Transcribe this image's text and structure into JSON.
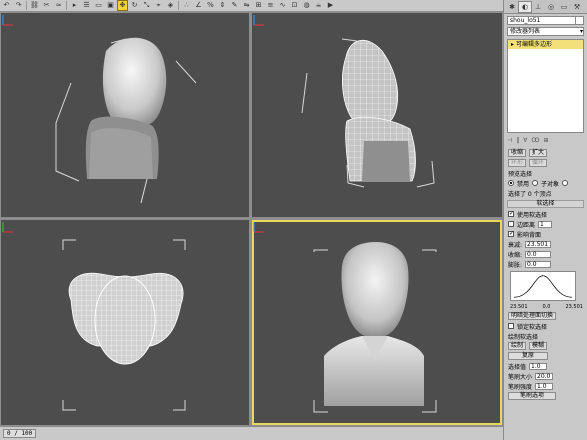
{
  "toolbar": {
    "icons": [
      "undo-icon",
      "redo-icon",
      "link-icon",
      "unlink-icon",
      "bind-icon",
      "select-icon",
      "select-name-icon",
      "rect-select-icon",
      "window-icon",
      "move-icon",
      "rotate-icon",
      "scale-icon",
      "coord-icon",
      "pivot-icon",
      "snap-icon",
      "angle-snap-icon",
      "percent-snap-icon",
      "spinner-snap-icon",
      "named-sel-icon",
      "mirror-icon",
      "align-icon",
      "layer-icon",
      "curve-icon",
      "schematic-icon",
      "material-icon",
      "render-icon",
      "quick-render-icon"
    ]
  },
  "panel": {
    "object_name": "shou_lo51",
    "modifier_list": "修改器列表",
    "stack_item": "可编辑多边形",
    "selection_buttons": [
      "顶点",
      "边"
    ],
    "by_vertex": "按顶点",
    "ignore_backface": "忽略背面",
    "shrink_label": "收缩",
    "grow_label": "扩大",
    "ring_label": "环形",
    "loop_label": "循环",
    "preview_label": "预览选择",
    "preview_off": "禁用",
    "preview_sub": "子对象",
    "preview_multi": "多个",
    "selected_status": "选择了 0 个顶点",
    "soft_title": "软选择",
    "use_soft": "使用软选择",
    "edge_distance": "边距离",
    "edge_distance_value": "1",
    "affect_backface": "影响背面",
    "falloff_label": "衰减:",
    "falloff_value": "23.501",
    "pinch_label": "收缩:",
    "pinch_value": "0.0",
    "bubble_label": "膨胀:",
    "bubble_value": "0.0",
    "curve_left": "23.501",
    "curve_mid": "0.0",
    "curve_right": "23.501",
    "shaded_face": "明暗处理面切换",
    "lock_soft": "锁定软选择",
    "paint_title": "绘制软选择",
    "paint_btn": "绘制",
    "blur_btn": "模糊",
    "revert_btn": "复原",
    "sel_value_label": "选择值",
    "sel_value": "1.0",
    "brush_size_label": "笔刷大小",
    "brush_size": "20.0",
    "brush_strength_label": "笔刷强度",
    "brush_strength": "1.0",
    "brush_options": "笔刷选项"
  },
  "statusbar": {
    "timeslider": "0 / 100"
  }
}
